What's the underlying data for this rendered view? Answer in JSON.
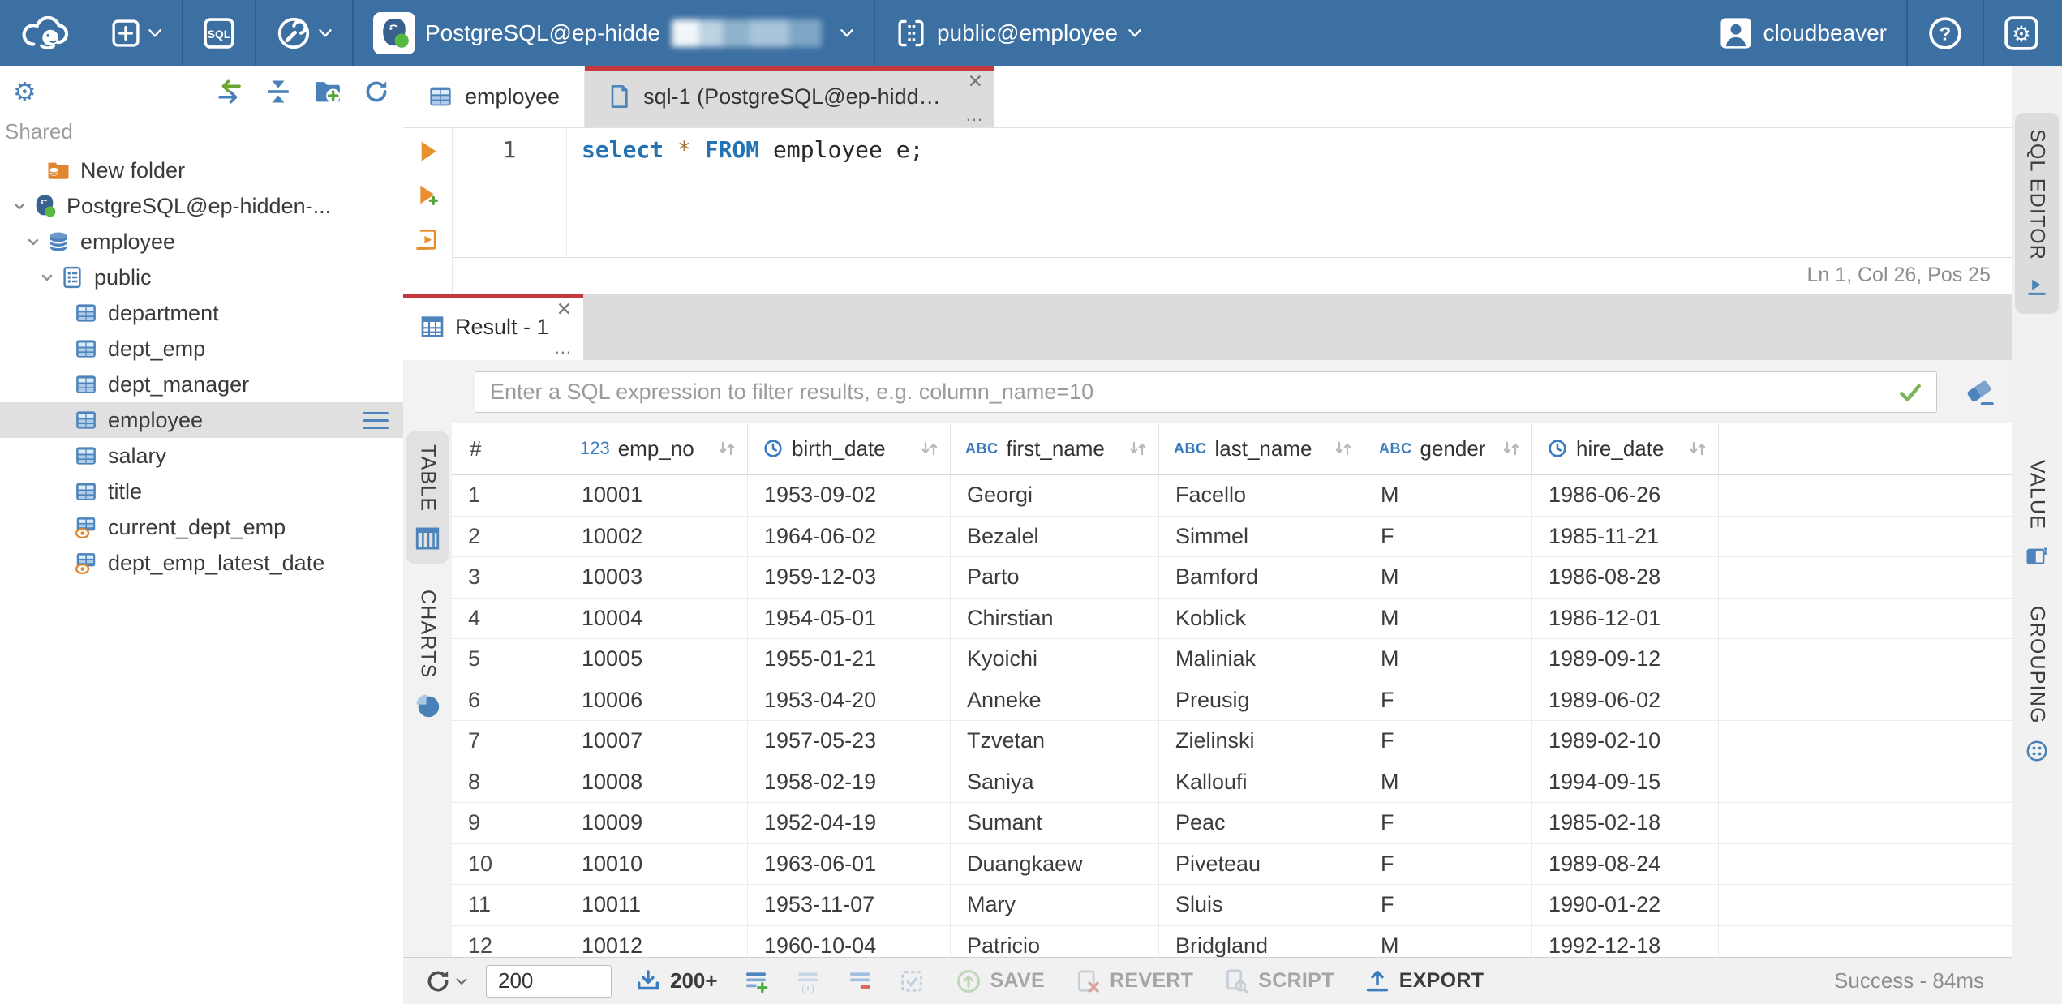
{
  "topbar": {
    "connection": {
      "label": "PostgreSQL@ep-hidde"
    },
    "schema": {
      "label": "public@employee"
    },
    "user": {
      "label": "cloudbeaver"
    },
    "sql_badge": "SQL",
    "help_glyph": "?",
    "gear_glyph": "⚙"
  },
  "sidebar": {
    "section": "Shared",
    "gear_glyph": "⚙",
    "tree": [
      {
        "label": "New folder"
      },
      {
        "label": "PostgreSQL@ep-hidden-..."
      },
      {
        "label": "employee"
      },
      {
        "label": "public"
      },
      {
        "label": "department"
      },
      {
        "label": "dept_emp"
      },
      {
        "label": "dept_manager"
      },
      {
        "label": "employee"
      },
      {
        "label": "salary"
      },
      {
        "label": "title"
      },
      {
        "label": "current_dept_emp"
      },
      {
        "label": "dept_emp_latest_date"
      }
    ]
  },
  "tabs": {
    "employee": "employee",
    "sql": "sql-1 (PostgreSQL@ep-hidde...",
    "close": "✕",
    "more": "..."
  },
  "editor": {
    "line_no": "1",
    "kw1": "select",
    "star": "*",
    "kw2": "FROM",
    "rest": "employee e;",
    "status": "Ln 1, Col 26, Pos 25"
  },
  "result": {
    "tab_label": "Result - 1",
    "close": "✕",
    "more": "...",
    "filter_placeholder": "Enter a SQL expression to filter results, e.g. column_name=10",
    "left_tabs": {
      "table": "TABLE",
      "charts": "CHARTS"
    },
    "right_tabs": {
      "sql_editor": "SQL EDITOR",
      "value": "VALUE",
      "grouping": "GROUPING"
    }
  },
  "table": {
    "row_number_header": "#",
    "type_icons": {
      "number": "123",
      "string": "ABC"
    },
    "columns": [
      {
        "type": "number",
        "label": "emp_no"
      },
      {
        "type": "datetime",
        "label": "birth_date"
      },
      {
        "type": "string",
        "label": "first_name"
      },
      {
        "type": "string",
        "label": "last_name"
      },
      {
        "type": "string",
        "label": "gender"
      },
      {
        "type": "datetime",
        "label": "hire_date"
      }
    ],
    "rows": [
      [
        "1",
        "10001",
        "1953-09-02",
        "Georgi",
        "Facello",
        "M",
        "1986-06-26"
      ],
      [
        "2",
        "10002",
        "1964-06-02",
        "Bezalel",
        "Simmel",
        "F",
        "1985-11-21"
      ],
      [
        "3",
        "10003",
        "1959-12-03",
        "Parto",
        "Bamford",
        "M",
        "1986-08-28"
      ],
      [
        "4",
        "10004",
        "1954-05-01",
        "Chirstian",
        "Koblick",
        "M",
        "1986-12-01"
      ],
      [
        "5",
        "10005",
        "1955-01-21",
        "Kyoichi",
        "Maliniak",
        "M",
        "1989-09-12"
      ],
      [
        "6",
        "10006",
        "1953-04-20",
        "Anneke",
        "Preusig",
        "F",
        "1989-06-02"
      ],
      [
        "7",
        "10007",
        "1957-05-23",
        "Tzvetan",
        "Zielinski",
        "F",
        "1989-02-10"
      ],
      [
        "8",
        "10008",
        "1958-02-19",
        "Saniya",
        "Kalloufi",
        "M",
        "1994-09-15"
      ],
      [
        "9",
        "10009",
        "1952-04-19",
        "Sumant",
        "Peac",
        "F",
        "1985-02-18"
      ],
      [
        "10",
        "10010",
        "1963-06-01",
        "Duangkaew",
        "Piveteau",
        "F",
        "1989-08-24"
      ],
      [
        "11",
        "10011",
        "1953-11-07",
        "Mary",
        "Sluis",
        "F",
        "1990-01-22"
      ],
      [
        "12",
        "10012",
        "1960-10-04",
        "Patricio",
        "Bridgland",
        "M",
        "1992-12-18"
      ]
    ]
  },
  "footer": {
    "row_limit": "200",
    "fetch_label": "200+",
    "save": "SAVE",
    "revert": "REVERT",
    "script": "SCRIPT",
    "export": "EXPORT",
    "status": "Success - 84ms"
  },
  "colors": {
    "topbar": "#3c6fa2",
    "accent_red": "#c5383c",
    "icon_blue": "#4d84bc",
    "green": "#57b944",
    "orange": "#e8902f"
  }
}
